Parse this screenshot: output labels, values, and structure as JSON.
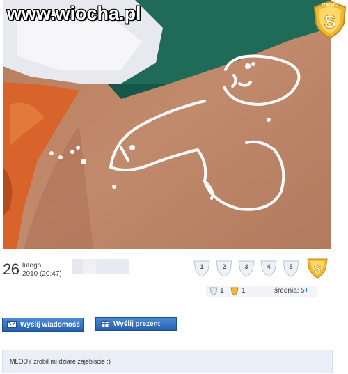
{
  "watermark": "www.wiocha.pl",
  "top_badge": {
    "label": "ZOBACZ",
    "icon": "super-shield-icon"
  },
  "post": {
    "day": "26",
    "month": "lutego",
    "time": "2010 (20:47)"
  },
  "rating": {
    "options": [
      "1",
      "2",
      "3",
      "4",
      "5"
    ],
    "best_icon": "super-shield-icon"
  },
  "stats": {
    "shield_count": "1",
    "super_count": "1",
    "average_label": "średnia:",
    "average_value": "5+"
  },
  "buttons": {
    "message": "Wyślij wiadomość",
    "gift": "Wyślij prezent"
  },
  "comment": {
    "text": "MŁODY zrobił mi dziare zajebiscie :)"
  },
  "colors": {
    "button": "#2561b0",
    "accent_blue": "#2a7fd4",
    "badge_gold": "#f0b830",
    "comment_bg": "#e9eef7"
  }
}
